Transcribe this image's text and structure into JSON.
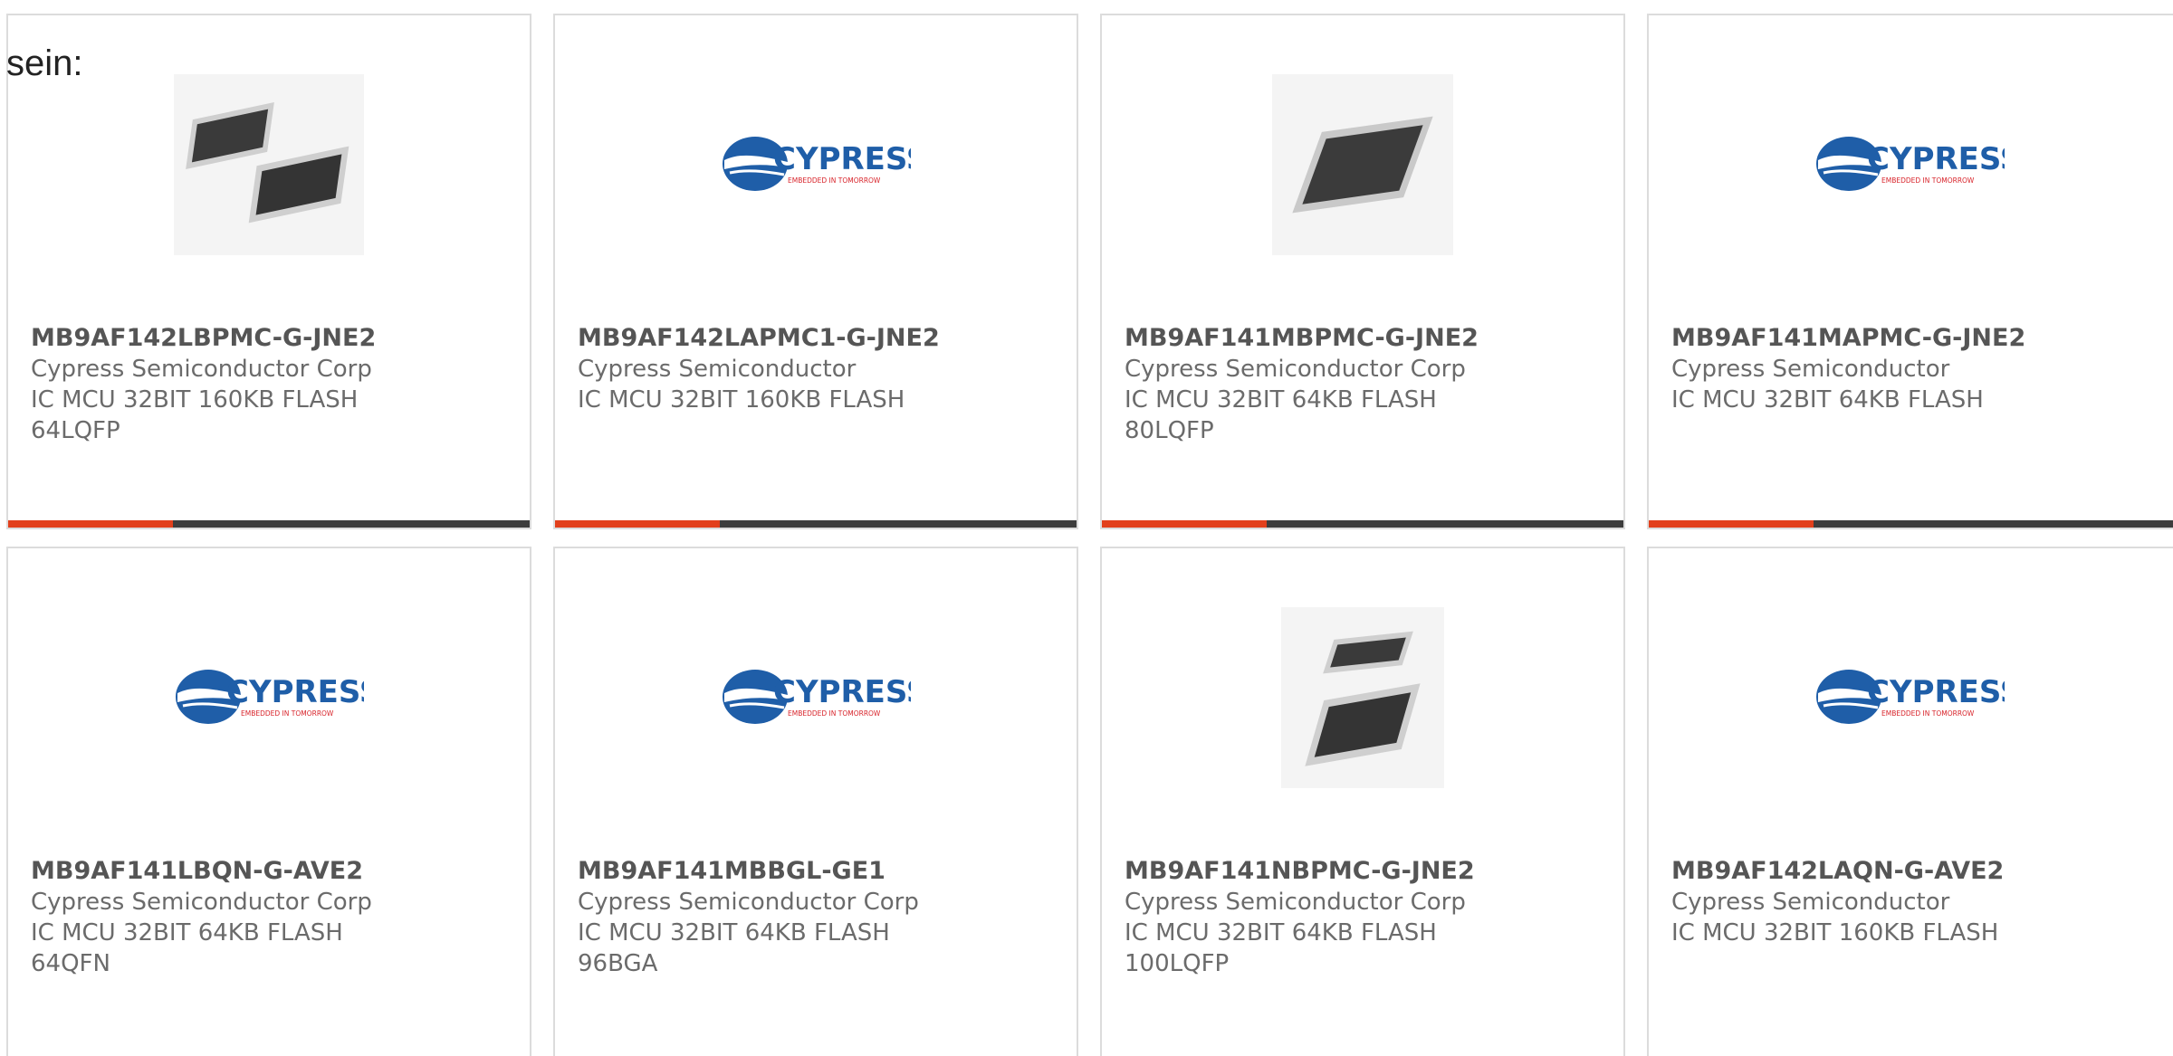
{
  "intro_text": "sein:",
  "colors": {
    "accent": "#e2401c",
    "bar": "#3d3d3d",
    "card_border": "#dcdcdc",
    "cypress_blue": "#1f5ea8",
    "cypress_red": "#d8232a"
  },
  "logo": {
    "wordmark": "CYPRESS",
    "tagline": "EMBEDDED IN TOMORROW"
  },
  "products": [
    {
      "image": "two-lqfp-chips-photo",
      "part_number": "MB9AF142LBPMC-G-JNE2",
      "manufacturer": "Cypress Semiconductor Corp",
      "description": "IC MCU 32BIT 160KB FLASH",
      "package": "64LQFP"
    },
    {
      "image": "cypress-logo",
      "part_number": "MB9AF142LAPMC1-G-JNE2",
      "manufacturer": "Cypress Semiconductor",
      "description": "IC MCU 32BIT 160KB FLASH",
      "package": ""
    },
    {
      "image": "single-lqfp-chip-photo",
      "part_number": "MB9AF141MBPMC-G-JNE2",
      "manufacturer": "Cypress Semiconductor Corp",
      "description": "IC MCU 32BIT 64KB FLASH",
      "package": "80LQFP"
    },
    {
      "image": "cypress-logo",
      "part_number": "MB9AF141MAPMC-G-JNE2",
      "manufacturer": "Cypress Semiconductor",
      "description": "IC MCU 32BIT 64KB FLASH",
      "package": ""
    },
    {
      "image": "cypress-logo",
      "part_number": "MB9AF141LBQN-G-AVE2",
      "manufacturer": "Cypress Semiconductor Corp",
      "description": "IC MCU 32BIT 64KB FLASH",
      "package": "64QFN"
    },
    {
      "image": "cypress-logo",
      "part_number": "MB9AF141MBBGL-GE1",
      "manufacturer": "Cypress Semiconductor Corp",
      "description": "IC MCU 32BIT 64KB FLASH",
      "package": "96BGA"
    },
    {
      "image": "two-lqfp-chips-photo",
      "part_number": "MB9AF141NBPMC-G-JNE2",
      "manufacturer": "Cypress Semiconductor Corp",
      "description": "IC MCU 32BIT 64KB FLASH",
      "package": "100LQFP"
    },
    {
      "image": "cypress-logo",
      "part_number": "MB9AF142LAQN-G-AVE2",
      "manufacturer": "Cypress Semiconductor",
      "description": "IC MCU 32BIT 160KB FLASH",
      "package": ""
    }
  ]
}
